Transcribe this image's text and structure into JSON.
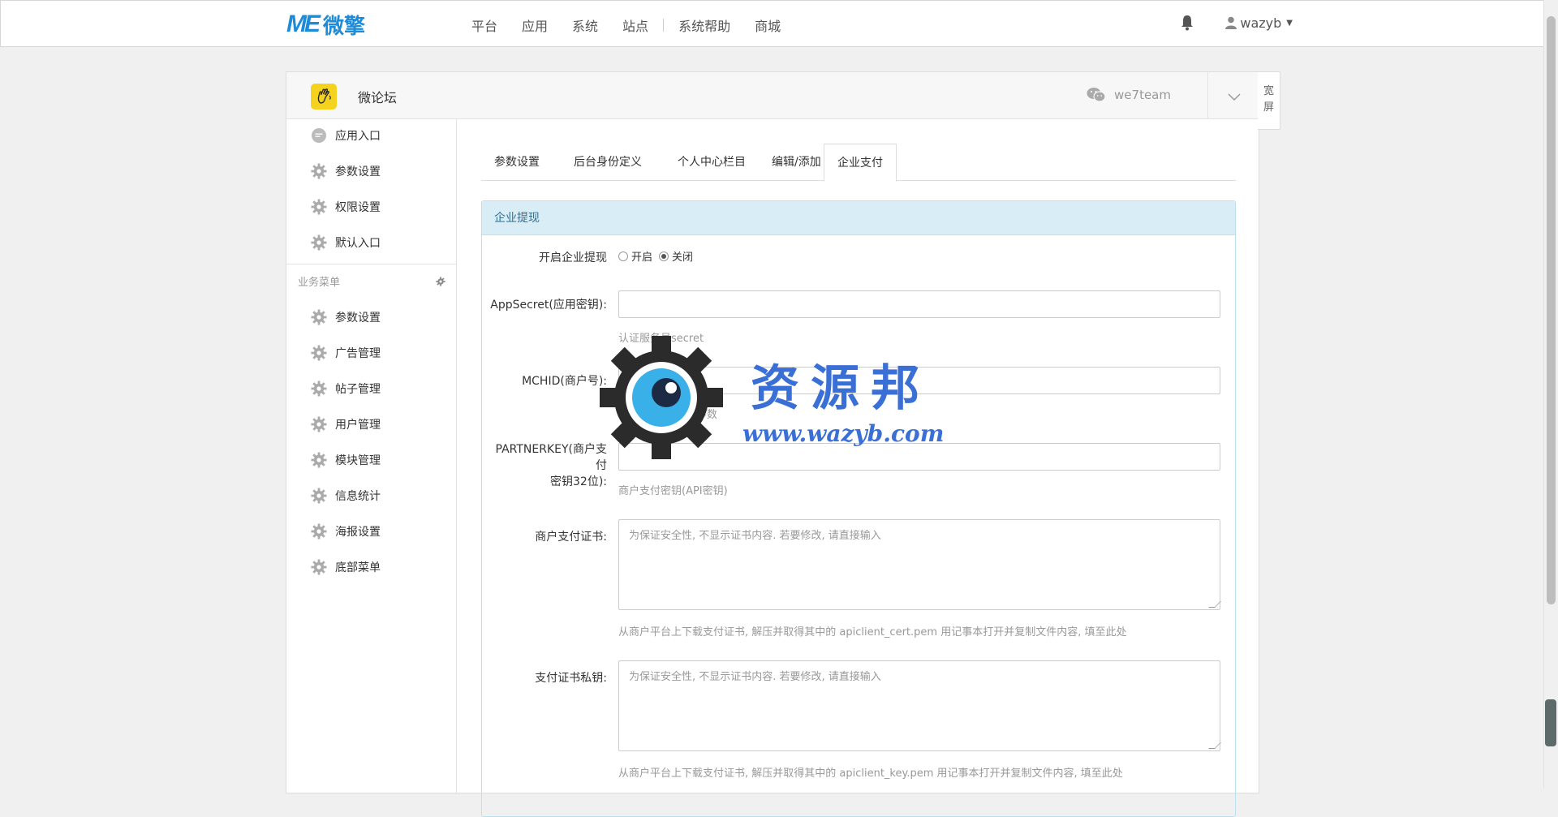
{
  "topbar": {
    "logo_mark": "ME",
    "logo_text": "微擎",
    "nav": [
      "平台",
      "应用",
      "系统",
      "站点",
      "系统帮助",
      "商城"
    ],
    "username": "wazyb"
  },
  "panel": {
    "app_title": "微论坛",
    "account_name": "we7team",
    "widescreen_label_1": "宽",
    "widescreen_label_2": "屏"
  },
  "sidebar": {
    "top_items": [
      {
        "label": "应用入口",
        "icon": "chat-icon"
      },
      {
        "label": "参数设置",
        "icon": "gear-icon"
      },
      {
        "label": "权限设置",
        "icon": "gear-icon"
      },
      {
        "label": "默认入口",
        "icon": "gear-icon"
      }
    ],
    "section_title": "业务菜单",
    "menu_items": [
      {
        "label": "参数设置"
      },
      {
        "label": "广告管理"
      },
      {
        "label": "帖子管理"
      },
      {
        "label": "用户管理"
      },
      {
        "label": "模块管理"
      },
      {
        "label": "信息统计"
      },
      {
        "label": "海报设置"
      },
      {
        "label": "底部菜单"
      }
    ]
  },
  "tabs": [
    {
      "label": "参数设置",
      "active": false
    },
    {
      "label": "后台身份定义",
      "active": false
    },
    {
      "label": "个人中心栏目",
      "active": false
    },
    {
      "label": "编辑/添加",
      "active": false
    },
    {
      "label": "企业支付",
      "active": true
    }
  ],
  "form": {
    "box_title": "企业提现",
    "enable_label": "开启企业提现",
    "enable_on": "开启",
    "enable_off": "关闭",
    "enable_value": "关闭",
    "appsecret_label": "AppSecret(应用密钥):",
    "appsecret_value": "",
    "appsecret_help": "认证服务号secret",
    "mchid_label": "MCHID(商户号):",
    "mchid_value": "",
    "mchid_help": "填入微信MCHID参数",
    "partnerkey_label_1": "PARTNERKEY(商户支付",
    "partnerkey_label_2": "密钥32位):",
    "partnerkey_value": "",
    "partnerkey_help": "商户支付密钥(API密钥)",
    "cert_label": "商户支付证书:",
    "cert_placeholder": "为保证安全性, 不显示证书内容. 若要修改, 请直接输入",
    "cert_help": "从商户平台上下载支付证书, 解压并取得其中的 apiclient_cert.pem 用记事本打开并复制文件内容, 填至此处",
    "key_label": "支付证书私钥:",
    "key_placeholder": "为保证安全性, 不显示证书内容. 若要修改, 请直接输入",
    "key_help": "从商户平台上下载支付证书, 解压并取得其中的 apiclient_key.pem 用记事本打开并复制文件内容, 填至此处"
  },
  "watermark": {
    "title": "资源邦",
    "url": "www.wazyb.com"
  },
  "colors": {
    "brand": "#1e8bd8",
    "box_header_bg": "#d9edf7",
    "box_header_text": "#31708f",
    "watermark": "#3a6fd6"
  }
}
